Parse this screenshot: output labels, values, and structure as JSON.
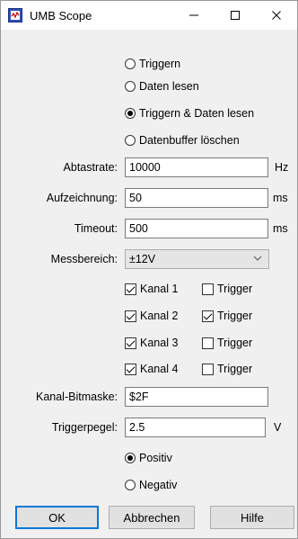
{
  "window": {
    "title": "UMB Scope"
  },
  "radios_top": [
    {
      "label": "Triggern",
      "checked": false
    },
    {
      "label": "Daten lesen",
      "checked": false
    },
    {
      "label": "Triggern & Daten lesen",
      "checked": true
    },
    {
      "label": "Datenbuffer löschen",
      "checked": false
    }
  ],
  "fields": {
    "abtastrate": {
      "label": "Abtastrate:",
      "value": "10000",
      "unit": "Hz"
    },
    "aufzeichnung": {
      "label": "Aufzeichnung:",
      "value": "50",
      "unit": "ms"
    },
    "timeout": {
      "label": "Timeout:",
      "value": "500",
      "unit": "ms"
    },
    "messbereich": {
      "label": "Messbereich:",
      "value": "±12V"
    },
    "bitmaske": {
      "label": "Kanal-Bitmaske:",
      "value": "$2F"
    },
    "triggerpegel": {
      "label": "Triggerpegel:",
      "value": "2.5",
      "unit": "V"
    }
  },
  "channels": [
    {
      "label": "Kanal 1",
      "checked": true,
      "trigger_label": "Trigger",
      "trigger": false
    },
    {
      "label": "Kanal 2",
      "checked": true,
      "trigger_label": "Trigger",
      "trigger": true
    },
    {
      "label": "Kanal 3",
      "checked": true,
      "trigger_label": "Trigger",
      "trigger": false
    },
    {
      "label": "Kanal 4",
      "checked": true,
      "trigger_label": "Trigger",
      "trigger": false
    }
  ],
  "polarity": [
    {
      "label": "Positiv",
      "checked": true
    },
    {
      "label": "Negativ",
      "checked": false
    }
  ],
  "buttons": {
    "ok": "OK",
    "cancel": "Abbrechen",
    "help": "Hilfe"
  },
  "icons": {
    "app": "scope-app-icon",
    "minimize": "minimize-icon",
    "maximize": "maximize-icon",
    "close": "close-icon",
    "dropdown": "chevron-down-icon"
  }
}
